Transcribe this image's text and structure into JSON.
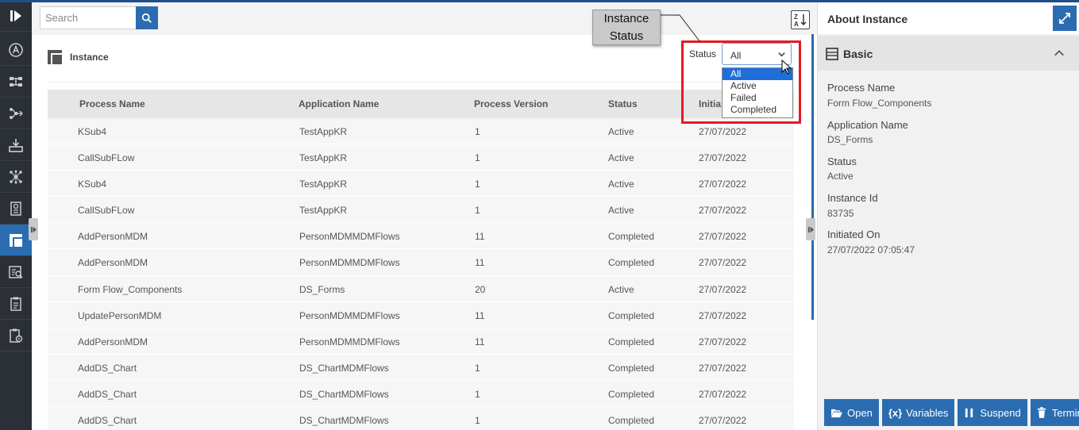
{
  "search": {
    "placeholder": "Search"
  },
  "page": {
    "title": "Instance"
  },
  "callout": {
    "line1": "Instance",
    "line2": "Status"
  },
  "status_filter": {
    "label": "Status",
    "selected": "All",
    "options": [
      "All",
      "Active",
      "Failed",
      "Completed"
    ]
  },
  "table": {
    "columns": [
      "Process Name",
      "Application Name",
      "Process Version",
      "Status",
      "Initia"
    ],
    "rows": [
      [
        "KSub4",
        "TestAppKR",
        "1",
        "Active",
        "27/07/2022"
      ],
      [
        "CallSubFLow",
        "TestAppKR",
        "1",
        "Active",
        "27/07/2022"
      ],
      [
        "KSub4",
        "TestAppKR",
        "1",
        "Active",
        "27/07/2022"
      ],
      [
        "CallSubFLow",
        "TestAppKR",
        "1",
        "Active",
        "27/07/2022"
      ],
      [
        "AddPersonMDM",
        "PersonMDMMDMFlows",
        "11",
        "Completed",
        "27/07/2022"
      ],
      [
        "AddPersonMDM",
        "PersonMDMMDMFlows",
        "11",
        "Completed",
        "27/07/2022"
      ],
      [
        "Form Flow_Components",
        "DS_Forms",
        "20",
        "Active",
        "27/07/2022"
      ],
      [
        "UpdatePersonMDM",
        "PersonMDMMDMFlows",
        "11",
        "Completed",
        "27/07/2022"
      ],
      [
        "AddPersonMDM",
        "PersonMDMMDMFlows",
        "11",
        "Completed",
        "27/07/2022"
      ],
      [
        "AddDS_Chart",
        "DS_ChartMDMFlows",
        "1",
        "Completed",
        "27/07/2022"
      ],
      [
        "AddDS_Chart",
        "DS_ChartMDMFlows",
        "1",
        "Completed",
        "27/07/2022"
      ],
      [
        "AddDS_Chart",
        "DS_ChartMDMFlows",
        "1",
        "Completed",
        "27/07/2022"
      ]
    ]
  },
  "panel": {
    "title": "About Instance",
    "section": "Basic",
    "fields": [
      {
        "label": "Process Name",
        "value": "Form Flow_Components"
      },
      {
        "label": "Application Name",
        "value": "DS_Forms"
      },
      {
        "label": "Status",
        "value": "Active"
      },
      {
        "label": "Instance Id",
        "value": "83735"
      },
      {
        "label": "Initiated On",
        "value": "27/07/2022 07:05:47"
      }
    ],
    "actions": [
      {
        "icon": "folder-open-icon",
        "label": "Open"
      },
      {
        "icon": "variables-icon",
        "glyph": "{x}",
        "label": "Variables"
      },
      {
        "icon": "pause-icon",
        "label": "Suspend"
      },
      {
        "icon": "trash-icon",
        "label": "Termin"
      }
    ]
  },
  "rail_icons": [
    "expand-rail-icon",
    "app-logo-icon",
    "workflow-icon",
    "process-flow-icon",
    "deploy-icon",
    "network-icon",
    "reports-icon",
    "instance-icon",
    "search-list-icon",
    "tasks-icon",
    "task-settings-icon"
  ],
  "colors": {
    "accent": "#2b6cb0",
    "rail": "#2b2f36",
    "highlight": "#e31b23",
    "selected_option": "#1e6fd9"
  }
}
